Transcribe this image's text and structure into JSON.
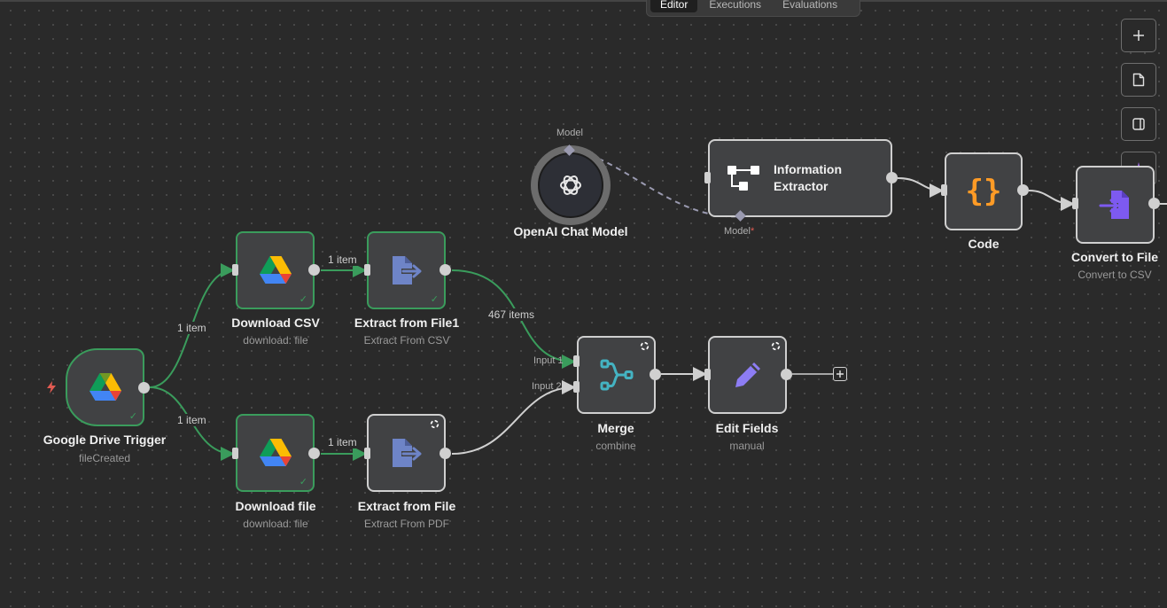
{
  "tabs": {
    "editor": "Editor",
    "executions": "Executions",
    "evaluations": "Evaluations"
  },
  "nodes": {
    "google_drive_trigger": {
      "title": "Google Drive Trigger",
      "subtitle": "fileCreated"
    },
    "download_csv": {
      "title": "Download CSV",
      "subtitle": "download: file"
    },
    "download_file": {
      "title": "Download file",
      "subtitle": "download: file"
    },
    "extract_from_file1": {
      "title": "Extract from File1",
      "subtitle": "Extract From CSV"
    },
    "extract_from_file": {
      "title": "Extract from File",
      "subtitle": "Extract From PDF"
    },
    "openai_chat_model": {
      "title": "OpenAI Chat Model",
      "port_label": "Model"
    },
    "information_extractor": {
      "title_line1": "Information",
      "title_line2": "Extractor",
      "port_label": "Model",
      "required_mark": "*"
    },
    "code": {
      "title": "Code",
      "glyph": "{}"
    },
    "convert_to_file": {
      "title": "Convert to File",
      "subtitle": "Convert to CSV"
    },
    "merge": {
      "title": "Merge",
      "subtitle": "combine",
      "input1": "Input 1",
      "input2": "Input 2"
    },
    "edit_fields": {
      "title": "Edit Fields",
      "subtitle": "manual"
    }
  },
  "edges": {
    "trigger_to_csv": "1 item",
    "trigger_to_file": "1 item",
    "csv_to_extract1": "1 item",
    "file_to_extract": "1 item",
    "extract1_to_merge": "467 items"
  },
  "colors": {
    "canvas": "#2a2a2a",
    "node_bg": "#414244",
    "success": "#3a9c5c",
    "trigger_icon": "#e25b52",
    "code_orange": "#ff9b26",
    "convert_purple": "#7d5af0",
    "extract_blue": "#6e84c7",
    "merge_teal": "#44b3c2",
    "edit_purple": "#8d7df4",
    "sparkle_purple": "#a56cf0"
  },
  "icons": {
    "toolbar": [
      "zoom-in-icon",
      "sticky-note-icon",
      "panel-toggle-icon",
      "ai-sparkle-icon"
    ]
  }
}
